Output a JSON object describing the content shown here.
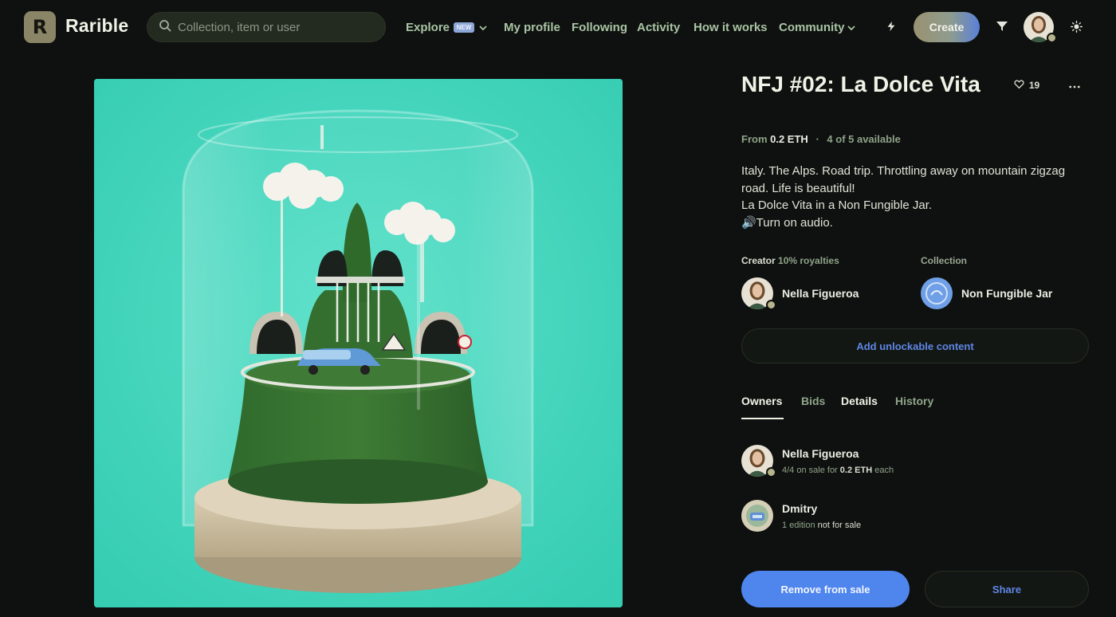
{
  "header": {
    "logo_glyph": "R",
    "brand": "Rarible",
    "search_placeholder": "Collection, item or user",
    "nav": {
      "explore": "Explore",
      "new_badge": "NEW",
      "my_profile": "My profile",
      "following": "Following",
      "activity": "Activity",
      "how_it_works": "How it works",
      "community": "Community"
    },
    "create_label": "Create",
    "icons": [
      "search-icon",
      "chevron-down-icon",
      "lightning-icon",
      "filter-icon",
      "sun-icon"
    ]
  },
  "item": {
    "title": "NFJ #02: La Dolce Vita",
    "likes": "19",
    "price_prefix": "From",
    "price": "0.2 ETH",
    "separator": "·",
    "availability": "4 of 5 available",
    "description": [
      "Italy. The Alps. Road trip. Throttling away on mountain zigzag",
      "road. Life is beautiful!",
      "La Dolce Vita in a Non Fungible Jar.",
      "🔊Turn on audio."
    ]
  },
  "creator": {
    "label": "Creator",
    "royalties": "10% royalties",
    "name": "Nella Figueroa"
  },
  "collection": {
    "label": "Collection",
    "name": "Non Fungible Jar"
  },
  "unlockable_label": "Add unlockable content",
  "tabs": [
    "Owners",
    "Bids",
    "Details",
    "History"
  ],
  "owners": [
    {
      "name": "Nella Figueroa",
      "qty": "4/4",
      "on_sale_text": "on sale for",
      "price": "0.2 ETH",
      "each": "each"
    },
    {
      "name": "Dmitry",
      "editions": "1 edition",
      "status": "not for sale"
    }
  ],
  "actions": {
    "remove": "Remove from sale",
    "share": "Share"
  },
  "colors": {
    "background": "#0f1110",
    "accent_blue": "#4f86ee",
    "muted_green": "#8ea388",
    "art_teal": "#43d6bd"
  }
}
